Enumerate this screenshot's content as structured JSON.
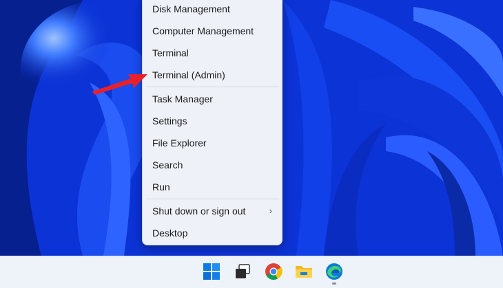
{
  "menu": {
    "items": [
      {
        "label": "Disk Management"
      },
      {
        "label": "Computer Management"
      },
      {
        "label": "Terminal"
      },
      {
        "label": "Terminal (Admin)"
      },
      {
        "label": "Task Manager"
      },
      {
        "label": "Settings"
      },
      {
        "label": "File Explorer"
      },
      {
        "label": "Search"
      },
      {
        "label": "Run"
      },
      {
        "label": "Shut down or sign out"
      },
      {
        "label": "Desktop"
      }
    ],
    "submenu_chevron": "›"
  },
  "taskbar": {
    "icons": [
      "windows-start-icon",
      "task-view-icon",
      "chrome-icon",
      "file-explorer-icon",
      "edge-icon"
    ]
  },
  "colors": {
    "wallpaper": "#0a2fd0",
    "annotation_arrow": "#e8202a",
    "menu_bg": "#eef1f8"
  }
}
